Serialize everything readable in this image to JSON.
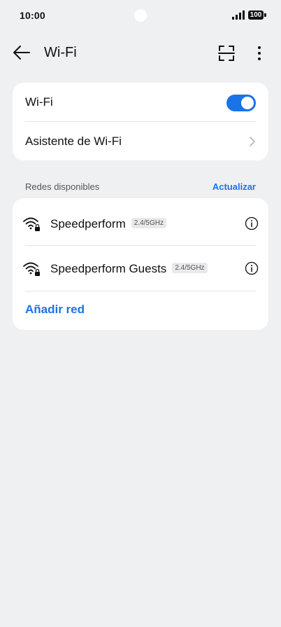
{
  "status": {
    "time": "10:00",
    "battery": "100"
  },
  "appbar": {
    "title": "Wi-Fi"
  },
  "wifi_card": {
    "wifi_label": "Wi-Fi",
    "wifi_enabled": true,
    "assistant_label": "Asistente de Wi-Fi"
  },
  "networks_section": {
    "label": "Redes disponibles",
    "refresh_label": "Actualizar"
  },
  "networks": [
    {
      "name": "Speedperform",
      "band": "2.4/5GHz"
    },
    {
      "name": "Speedperform Guests",
      "band": "2.4/5GHz"
    }
  ],
  "add_network_label": "Añadir red",
  "colors": {
    "accent": "#1a73e8",
    "background": "#eff0f2",
    "card": "#ffffff"
  },
  "icons": [
    "back-arrow-icon",
    "scan-qr-icon",
    "more-vert-icon",
    "wifi-lock-icon",
    "info-icon",
    "chevron-right-icon",
    "signal-icon",
    "battery-icon"
  ]
}
